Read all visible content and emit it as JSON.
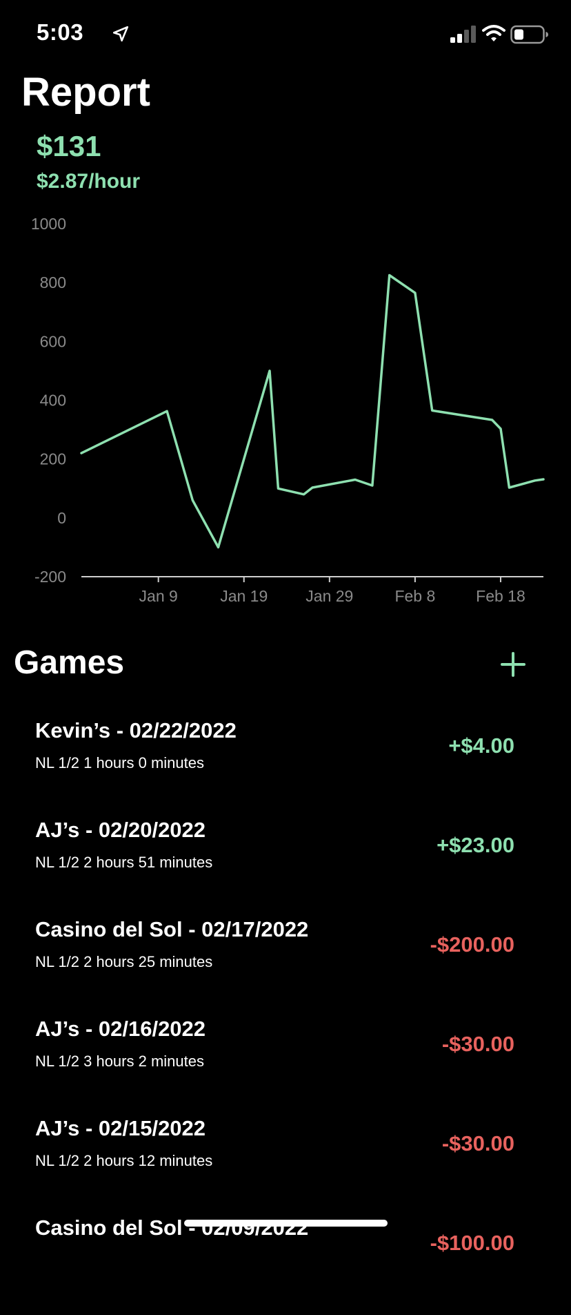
{
  "status_bar": {
    "time": "5:03",
    "icons": [
      "location-arrow-icon",
      "cellular-signal-icon",
      "wifi-icon",
      "battery-icon"
    ]
  },
  "colors": {
    "background": "#000000",
    "positive": "#8ee0b0",
    "negative": "#e8625e",
    "axis_text": "#8a8a8a"
  },
  "report": {
    "title": "Report",
    "total": "$131",
    "hourly": "$2.87/hour"
  },
  "chart_data": {
    "type": "line",
    "title": "",
    "xlabel": "",
    "ylabel": "",
    "ylim": [
      -200,
      1000
    ],
    "yticks": [
      1000,
      800,
      600,
      400,
      200,
      0,
      -200
    ],
    "xticks": [
      {
        "date": "2022-01-09",
        "label": "Jan 9"
      },
      {
        "date": "2022-01-19",
        "label": "Jan 19"
      },
      {
        "date": "2022-01-29",
        "label": "Jan 29"
      },
      {
        "date": "2022-02-08",
        "label": "Feb 8"
      },
      {
        "date": "2022-02-18",
        "label": "Feb 18"
      }
    ],
    "xlim": [
      "2021-12-31",
      "2022-02-23"
    ],
    "grid": false,
    "series": [
      {
        "color": "#8ee0b0",
        "points": [
          {
            "x": "2021-12-31",
            "y": 220
          },
          {
            "x": "2022-01-10",
            "y": 363
          },
          {
            "x": "2022-01-13",
            "y": 60
          },
          {
            "x": "2022-01-16",
            "y": -100
          },
          {
            "x": "2022-01-22",
            "y": 500
          },
          {
            "x": "2022-01-23",
            "y": 100
          },
          {
            "x": "2022-01-26",
            "y": 80
          },
          {
            "x": "2022-01-27",
            "y": 103
          },
          {
            "x": "2022-02-01",
            "y": 130
          },
          {
            "x": "2022-02-03",
            "y": 110
          },
          {
            "x": "2022-02-05",
            "y": 825
          },
          {
            "x": "2022-02-08",
            "y": 765
          },
          {
            "x": "2022-02-10",
            "y": 365
          },
          {
            "x": "2022-02-17",
            "y": 333
          },
          {
            "x": "2022-02-18",
            "y": 303
          },
          {
            "x": "2022-02-19",
            "y": 103
          },
          {
            "x": "2022-02-22",
            "y": 127
          },
          {
            "x": "2022-02-23",
            "y": 131
          }
        ]
      }
    ]
  },
  "games": {
    "title": "Games",
    "add_icon": "plus-icon",
    "items": [
      {
        "title": "Kevin’s - 02/22/2022",
        "subtitle": "NL 1/2 1 hours 0 minutes",
        "amount": "+$4.00",
        "positive": true
      },
      {
        "title": "AJ’s - 02/20/2022",
        "subtitle": "NL 1/2 2 hours 51 minutes",
        "amount": "+$23.00",
        "positive": true
      },
      {
        "title": "Casino del Sol - 02/17/2022",
        "subtitle": "NL 1/2 2 hours 25 minutes",
        "amount": "-$200.00",
        "positive": false
      },
      {
        "title": "AJ’s - 02/16/2022",
        "subtitle": "NL 1/2 3 hours 2 minutes",
        "amount": "-$30.00",
        "positive": false
      },
      {
        "title": "AJ’s - 02/15/2022",
        "subtitle": "NL 1/2 2 hours 12 minutes",
        "amount": "-$30.00",
        "positive": false
      },
      {
        "title": "Casino del Sol - 02/09/2022",
        "subtitle": "",
        "amount": "-$100.00",
        "positive": false
      }
    ]
  }
}
